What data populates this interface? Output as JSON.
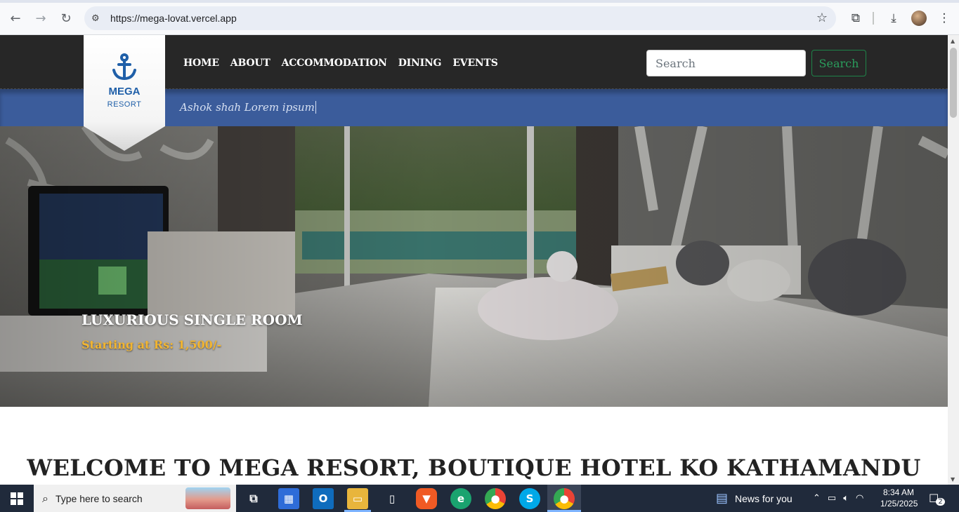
{
  "browser": {
    "url": "https://mega-lovat.vercel.app"
  },
  "site": {
    "logo": {
      "name": "MEGA",
      "sub": "RESORT"
    },
    "nav": [
      "HOME",
      "ABOUT",
      "ACCOMMODATION",
      "DINING",
      "EVENTS"
    ],
    "search": {
      "placeholder": "Search",
      "button": "Search"
    },
    "ticker": "Ashok shah Lorem ipsum",
    "hero": {
      "title": "LUXURIOUS SINGLE ROOM",
      "price": "Starting at Rs: 1,500/-"
    },
    "welcome": "WELCOME TO MEGA RESORT, BOUTIQUE HOTEL KO KATHAMANDU"
  },
  "taskbar": {
    "search_placeholder": "Type here to search",
    "news": "News for you",
    "time": "8:34 AM",
    "date": "1/25/2025",
    "notifications": "2"
  },
  "colors": {
    "nav_bg": "#272727",
    "ticker_bg": "#3b5c9b",
    "logo_blue": "#1f5fa8",
    "price_gold": "#f2b531",
    "search_green": "#2a9d5c",
    "taskbar_bg": "#202a3b"
  }
}
